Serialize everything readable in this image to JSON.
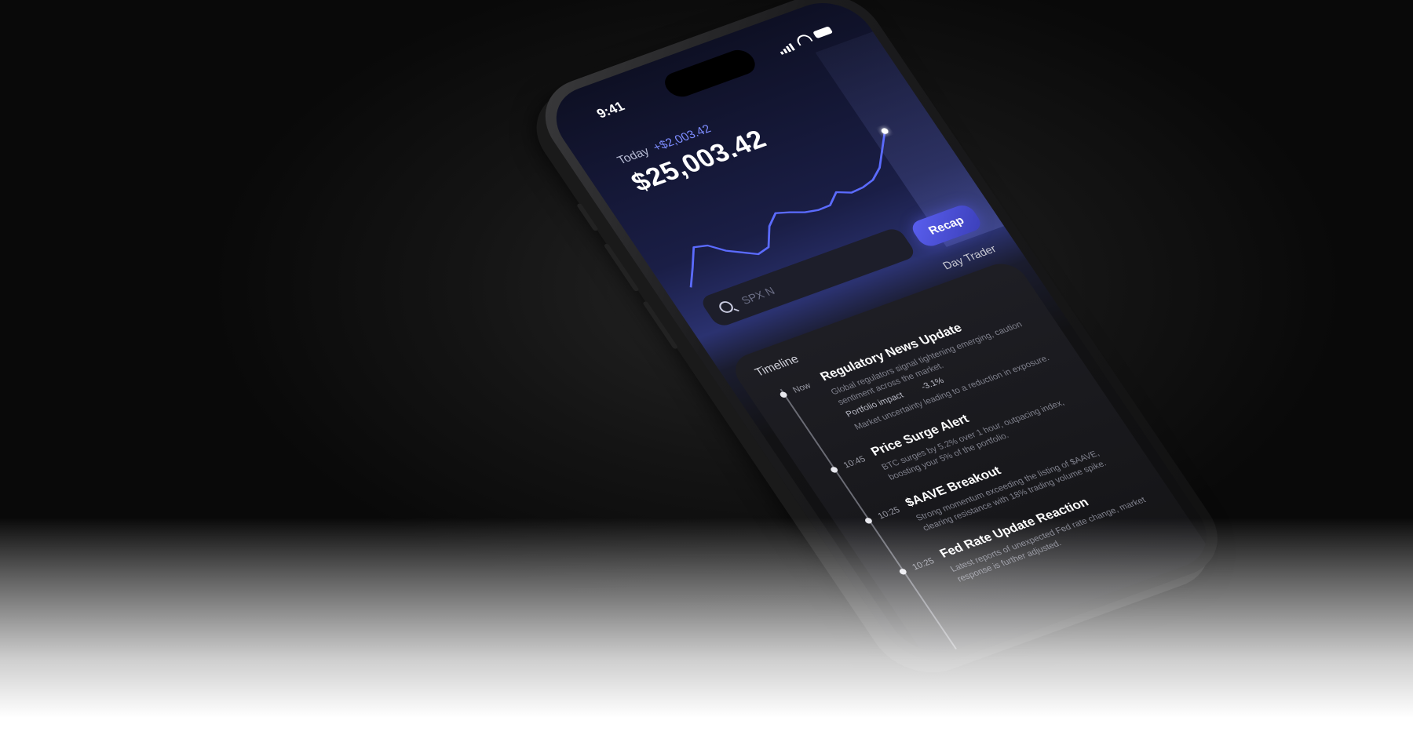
{
  "status_bar": {
    "time": "9:41"
  },
  "portfolio": {
    "today_label": "Today",
    "today_change": "+$2,003.42",
    "balance": "$25,003.42"
  },
  "chart_data": {
    "type": "line",
    "x": [
      0,
      1,
      2,
      3,
      4,
      5,
      6,
      7,
      8,
      9,
      10,
      11,
      12,
      13,
      14,
      15,
      16,
      17,
      18,
      19,
      20
    ],
    "values": [
      2.0,
      5.5,
      9.2,
      8.6,
      6.4,
      5.0,
      3.6,
      4.2,
      8.0,
      10.0,
      9.2,
      8.2,
      7.7,
      7.8,
      9.8,
      8.7,
      8.9,
      9.6,
      11.4,
      14.6,
      17.8
    ],
    "title": "",
    "xlabel": "",
    "ylabel": "",
    "ylim": [
      0,
      20
    ],
    "grid": false,
    "accent_color": "#5b6bff",
    "highlight_last_point": true
  },
  "actions": {
    "recap_label": "Recap"
  },
  "search": {
    "placeholder": "SPX N"
  },
  "mode": {
    "label": "Day Trader"
  },
  "timeline": {
    "title": "Timeline",
    "items": [
      {
        "time": "Now",
        "headline": "Regulatory News Update",
        "description": "Global regulators signal tightening emerging, caution sentiment across the market.",
        "meta_label": "Portfolio impact",
        "meta_value": "-3.1%",
        "note": "Market uncertainty leading to a reduction in exposure."
      },
      {
        "time": "10:45",
        "headline": "Price Surge Alert",
        "description": "BTC surges by 5.2% over 1 hour, outpacing index, boosting your 5% of the portfolio."
      },
      {
        "time": "10:25",
        "headline": "$AAVE Breakout",
        "description": "Strong momentum exceeding the listing of $AAVE, clearing resistance with 18% trading volume spike."
      },
      {
        "time": "10:25",
        "headline": "Fed Rate Update Reaction",
        "description": "Latest reports of unexpected Fed rate change, market response is further adjusted."
      }
    ]
  }
}
